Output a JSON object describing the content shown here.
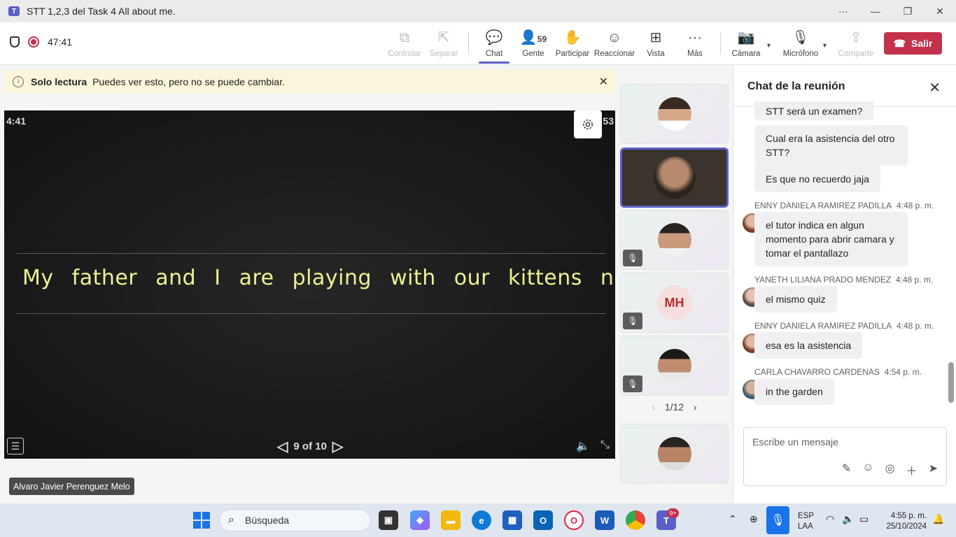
{
  "window": {
    "title": "STT 1,2,3 del Task 4 All about me."
  },
  "toolbar": {
    "timer": "47:41",
    "controlar": "Controlar",
    "separar": "Separar",
    "chat": "Chat",
    "gente": "Gente",
    "gente_count": "59",
    "participar": "Participar",
    "reaccionar": "Reaccionar",
    "vista": "Vista",
    "mas": "Más",
    "camara": "Cámara",
    "microfono": "Micrófono",
    "comparte": "Comparte",
    "salir": "Salir"
  },
  "banner": {
    "title": "Solo lectura",
    "message": "Puedes ver esto, pero no se puede cambiar."
  },
  "stage": {
    "time": "4:41",
    "counter": "53",
    "sentence": "My father and I are playing with our kittens now.",
    "pager": "9 of 10",
    "presenter": "Alvaro Javier Perenguez Melo"
  },
  "participants": {
    "mh_initials": "MH",
    "page": "1/12"
  },
  "chat": {
    "header": "Chat de la reunión",
    "messages": [
      {
        "text": "STT será un examen?"
      },
      {
        "text": "Cual era la asistencia del otro STT?"
      },
      {
        "text": "Es que no recuerdo jaja"
      },
      {
        "author": "ENNY DANIELA RAMIREZ PADILLA",
        "time": "4:48 p. m.",
        "text": "el tutor indica en algun momento para abrir camara y tomar el pantallazo"
      },
      {
        "author": "YANETH LILIANA PRADO MENDEZ",
        "time": "4:48 p. m.",
        "text": "el mismo quiz"
      },
      {
        "author": "ENNY DANIELA RAMIREZ PADILLA",
        "time": "4:48 p. m.",
        "text": "esa es la asistencia"
      },
      {
        "author": "CARLA CHAVARRO CARDENAS",
        "time": "4:54 p. m.",
        "text": "in the garden"
      }
    ],
    "placeholder": "Escribe un mensaje"
  },
  "taskbar": {
    "search": "Búsqueda",
    "teams_badge": "9+",
    "lang1": "ESP",
    "lang2": "LAA",
    "time": "4:55 p. m.",
    "date": "25/10/2024"
  },
  "colors": {
    "accent": "#5b5fc7",
    "leave": "#c4314b",
    "chalk": "#eef094"
  }
}
